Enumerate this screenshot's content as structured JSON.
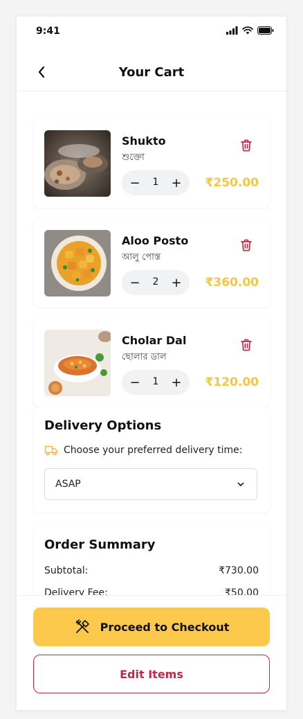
{
  "status_bar": {
    "time": "9:41"
  },
  "header": {
    "title": "Your Cart"
  },
  "items": [
    {
      "name": "Shukto",
      "local_name": "শুক্তো",
      "quantity": "1",
      "price": "₹250.00"
    },
    {
      "name": "Aloo Posto",
      "local_name": "আলু পোস্ত",
      "quantity": "2",
      "price": "₹360.00"
    },
    {
      "name": "Cholar Dal",
      "local_name": "ছোলার ডাল",
      "quantity": "1",
      "price": "₹120.00"
    }
  ],
  "stepper": {
    "minus": "−",
    "plus": "+"
  },
  "delivery": {
    "title": "Delivery Options",
    "hint": "Choose your preferred delivery time:",
    "selected": "ASAP"
  },
  "summary": {
    "title": "Order Summary",
    "rows": [
      {
        "label": "Subtotal:",
        "value": "₹730.00"
      },
      {
        "label": "Delivery Fee:",
        "value": "₹50.00"
      }
    ]
  },
  "actions": {
    "checkout_label": "Proceed to Checkout",
    "edit_label": "Edit Items"
  },
  "colors": {
    "accent_yellow": "#fcc94d",
    "price_yellow": "#f5c646",
    "danger_red": "#c02848",
    "delivery_icon": "#f4b73c"
  },
  "icons": {
    "back": "chevron-left-icon",
    "delete": "trash-icon",
    "delivery": "truck-icon",
    "select": "chevron-down-icon",
    "checkout": "utensils-crossed-icon"
  }
}
